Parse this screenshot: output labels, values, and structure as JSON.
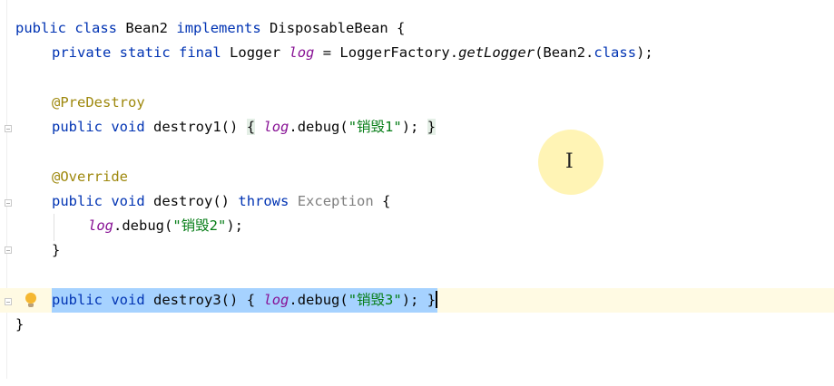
{
  "editor": {
    "line1": {
      "kw1": "public",
      "kw2": "class",
      "cls": "Bean2",
      "kw3": "implements",
      "iface": "DisposableBean",
      "brace": "{"
    },
    "line2": {
      "kw1": "private",
      "kw2": "static",
      "kw3": "final",
      "type": "Logger",
      "field": "log",
      "eq": "=",
      "factory": "LoggerFactory.",
      "method": "getLogger",
      "arg_open": "(Bean2.",
      "arg_kw": "class",
      "arg_close": ");"
    },
    "line3": {
      "annotation": "@PreDestroy"
    },
    "line4": {
      "kw1": "public",
      "kw2": "void",
      "name": "destroy1()",
      "open": "{",
      "field": "log",
      "call": ".debug(",
      "str": "\"销毁1\"",
      "end": ");",
      "close": "}"
    },
    "line5": {
      "annotation": "@Override"
    },
    "line6": {
      "kw1": "public",
      "kw2": "void",
      "name": "destroy()",
      "kw3": "throws",
      "exc": "Exception",
      "brace": "{"
    },
    "line7": {
      "field": "log",
      "call": ".debug(",
      "str": "\"销毁2\"",
      "end": ");"
    },
    "line8": {
      "brace": "}"
    },
    "line9": {
      "kw1": "public",
      "kw2": "void",
      "name": "destroy3()",
      "open": "{",
      "field": "log",
      "call": ".debug(",
      "str": "\"销毁3\"",
      "end": ");",
      "close": "}"
    },
    "line10": {
      "brace": "}"
    }
  },
  "colors": {
    "keyword": "#0033b3",
    "annotation": "#9e880d",
    "field": "#871094",
    "string": "#067d17",
    "selection": "#a6d2ff",
    "current_line": "#fffae3"
  },
  "icons": {
    "intention": "lightbulb-icon",
    "cursor": "text-cursor-icon"
  }
}
